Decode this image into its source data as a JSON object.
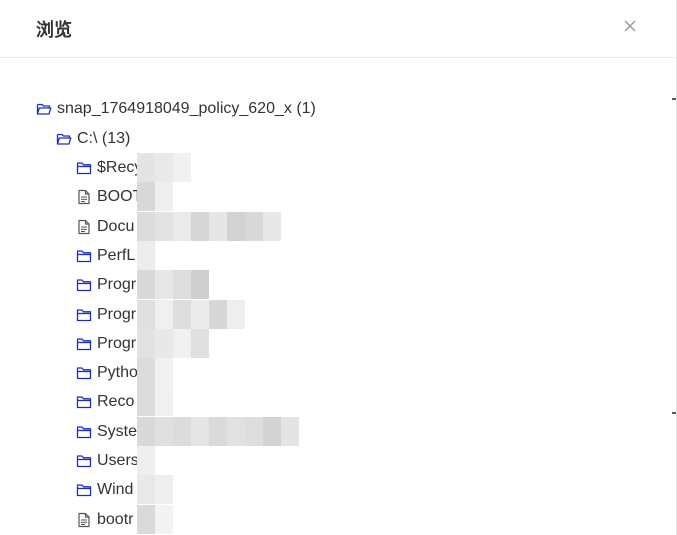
{
  "dialog": {
    "title": "浏览",
    "close_icon": "close-icon"
  },
  "tree": {
    "root": {
      "label": "snap_1764918049_policy_620_x (1)",
      "icon": "folder-open-icon"
    },
    "drive": {
      "label": "C:\\ (13)",
      "icon": "folder-open-icon"
    },
    "children": [
      {
        "label": "$Recy",
        "icon": "folder-icon",
        "type": "folder"
      },
      {
        "label": "BOOT",
        "icon": "file-icon",
        "type": "file"
      },
      {
        "label": "Docu",
        "icon": "file-icon",
        "type": "file"
      },
      {
        "label": "PerfL",
        "icon": "folder-icon",
        "type": "folder"
      },
      {
        "label": "Progr",
        "icon": "folder-icon",
        "type": "folder"
      },
      {
        "label": "Progr",
        "icon": "folder-icon",
        "type": "folder"
      },
      {
        "label": "Progr",
        "icon": "folder-icon",
        "type": "folder"
      },
      {
        "label": "Pytho",
        "icon": "folder-icon",
        "type": "folder"
      },
      {
        "label": "Reco",
        "icon": "folder-icon",
        "type": "folder"
      },
      {
        "label": "Syste",
        "icon": "folder-icon",
        "type": "folder"
      },
      {
        "label": "Users",
        "icon": "folder-icon",
        "type": "folder"
      },
      {
        "label": "Wind",
        "icon": "folder-icon",
        "type": "folder"
      },
      {
        "label": "bootr",
        "icon": "file-icon",
        "type": "file"
      }
    ]
  },
  "colors": {
    "folder_icon": "#1a2fbf",
    "file_icon": "#555555",
    "text": "#333333",
    "divider": "#e8e8e8",
    "close_icon": "#999999"
  }
}
